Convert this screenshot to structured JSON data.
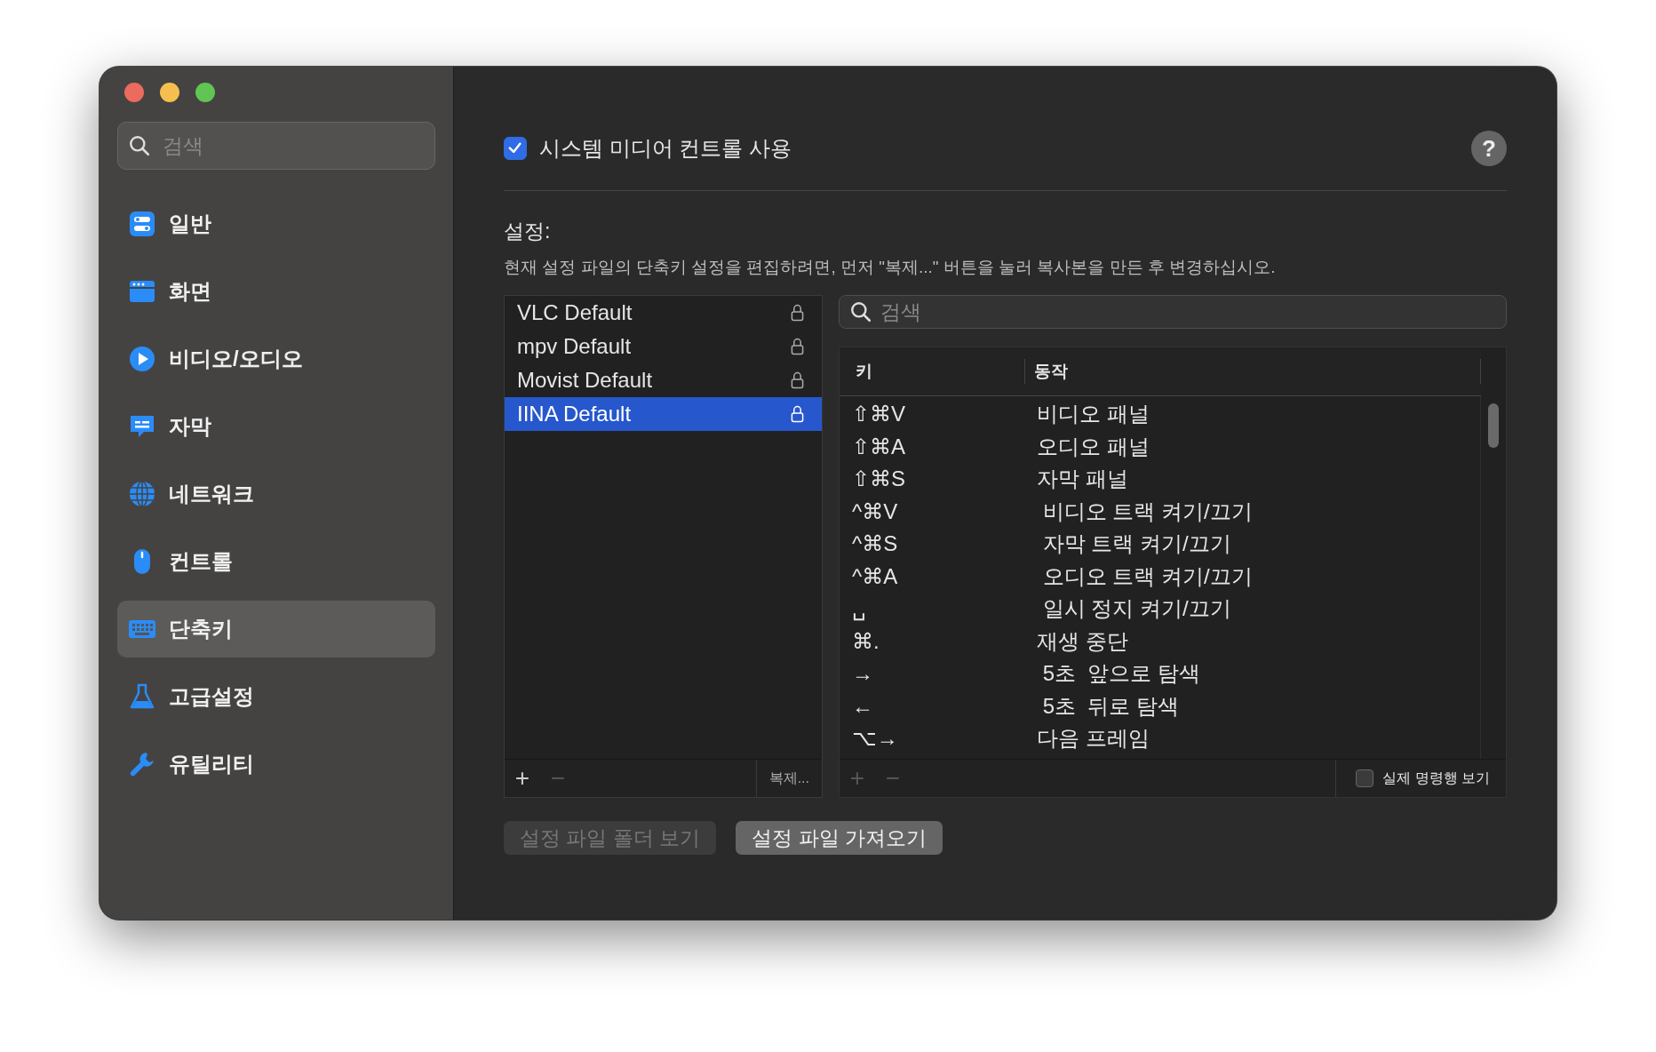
{
  "sidebar": {
    "search": {
      "placeholder": "검색"
    },
    "items": [
      {
        "label": "일반",
        "selected": false
      },
      {
        "label": "화면",
        "selected": false
      },
      {
        "label": "비디오/오디오",
        "selected": false
      },
      {
        "label": "자막",
        "selected": false
      },
      {
        "label": "네트워크",
        "selected": false
      },
      {
        "label": "컨트롤",
        "selected": false
      },
      {
        "label": "단축키",
        "selected": true
      },
      {
        "label": "고급설정",
        "selected": false
      },
      {
        "label": "유틸리티",
        "selected": false
      }
    ]
  },
  "media_control": {
    "label": "시스템 미디어 컨트롤 사용",
    "checked": true
  },
  "help_button": "?",
  "settings": {
    "heading": "설정:",
    "description": "현재 설정 파일의 단축키 설정을 편집하려면, 먼저 \"복제...\" 버튼을 눌러 복사본을 만든 후 변경하십시오."
  },
  "profiles": {
    "items": [
      {
        "name": "VLC Default",
        "selected": false
      },
      {
        "name": "mpv Default",
        "selected": false
      },
      {
        "name": "Movist Default",
        "selected": false
      },
      {
        "name": "IINA Default",
        "selected": true
      }
    ],
    "footer": [
      {
        "label": "+",
        "disabled": false
      },
      {
        "label": "−",
        "disabled": true
      }
    ],
    "duplicate_button": "복제..."
  },
  "shortcuts": {
    "search": {
      "placeholder": "검색"
    },
    "columns": [
      "키",
      "동작"
    ],
    "rows": [
      {
        "key": "⇧⌘V",
        "action": "비디오 패널"
      },
      {
        "key": "⇧⌘A",
        "action": "오디오 패널"
      },
      {
        "key": "⇧⌘S",
        "action": "자막 패널"
      },
      {
        "key": "^⌘V",
        "action": " 비디오 트랙 켜기/끄기"
      },
      {
        "key": "^⌘S",
        "action": " 자막 트랙 켜기/끄기"
      },
      {
        "key": "^⌘A",
        "action": " 오디오 트랙 켜기/끄기"
      },
      {
        "key": "␣",
        "action": " 일시 정지 켜기/끄기"
      },
      {
        "key": "⌘.",
        "action": "재생 중단"
      },
      {
        "key": "→",
        "action": " 5초  앞으로 탐색"
      },
      {
        "key": "←",
        "action": " 5초  뒤로 탐색"
      },
      {
        "key": "⌥→",
        "action": "다음 프레임"
      }
    ],
    "footer": [
      {
        "label": "+",
        "disabled": true
      },
      {
        "label": "−",
        "disabled": true
      }
    ],
    "raw_command": {
      "label": "실제 명령행 보기",
      "checked": false
    }
  },
  "buttons": [
    {
      "label": "설정 파일 폴더 보기",
      "disabled": true
    },
    {
      "label": "설정 파일 가져오기",
      "disabled": false
    }
  ]
}
